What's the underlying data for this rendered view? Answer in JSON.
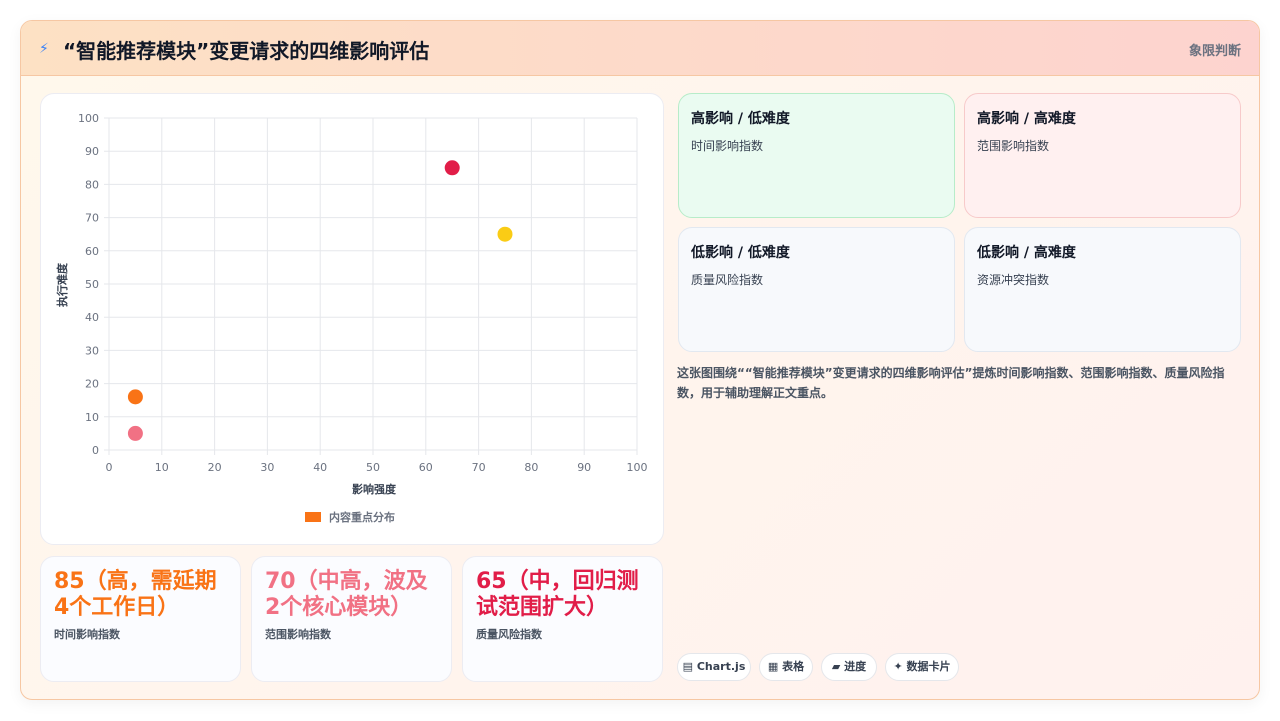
{
  "header": {
    "icon": "lightning-icon",
    "title": "“智能推荐模块”变更请求的四维影响评估",
    "tag": "象限判断"
  },
  "chart_data": {
    "type": "scatter",
    "xlabel": "影响强度",
    "ylabel": "执行难度",
    "xlim": [
      0,
      100
    ],
    "ylim": [
      0,
      100
    ],
    "x_ticks": [
      0,
      10,
      20,
      30,
      40,
      50,
      60,
      70,
      80,
      90,
      100
    ],
    "y_ticks": [
      0,
      10,
      20,
      30,
      40,
      50,
      60,
      70,
      80,
      90,
      100
    ],
    "grid": true,
    "legend": {
      "position": "bottom",
      "label": "内容重点分布",
      "color": "#f97316"
    },
    "points": [
      {
        "x": 65,
        "y": 85,
        "color": "#e11d48"
      },
      {
        "x": 75,
        "y": 65,
        "color": "#facc15"
      },
      {
        "x": 5,
        "y": 16,
        "color": "#f97316"
      },
      {
        "x": 5,
        "y": 5,
        "color": "#f17184"
      }
    ]
  },
  "stats": [
    {
      "value": "85（高，需延期4个工作日）",
      "label": "时间影响指数",
      "color": "#f97316"
    },
    {
      "value": "70（中高，波及2个核心模块）",
      "label": "范围影响指数",
      "color": "#f17184"
    },
    {
      "value": "65（中，回归测试范围扩大）",
      "label": "质量风险指数",
      "color": "#e11d48"
    }
  ],
  "quadrants": [
    {
      "title": "高影响 / 低难度",
      "sub": "时间影响指数",
      "bg": "#eafbf1",
      "border": "#b7ecc9"
    },
    {
      "title": "高影响 / 高难度",
      "sub": "范围影响指数",
      "bg": "#fff0f0",
      "border": "#f7caca"
    },
    {
      "title": "低影响 / 低难度",
      "sub": "质量风险指数",
      "bg": "#f7f9fc",
      "border": "#e2e8f0"
    },
    {
      "title": "低影响 / 高难度",
      "sub": "资源冲突指数",
      "bg": "#f7f9fc",
      "border": "#e2e8f0"
    }
  ],
  "description": "这张图围绕““智能推荐模块”变更请求的四维影响评估”提炼时间影响指数、范围影响指数、质量风险指数，用于辅助理解正文重点。",
  "chips": [
    {
      "icon": "chart-icon",
      "glyph": "▤",
      "label": "Chart.js"
    },
    {
      "icon": "table-icon",
      "glyph": "▦",
      "label": "表格"
    },
    {
      "icon": "progress-icon",
      "glyph": "▰",
      "label": "进度"
    },
    {
      "icon": "sparkle-icon",
      "glyph": "✦",
      "label": "数据卡片"
    }
  ]
}
